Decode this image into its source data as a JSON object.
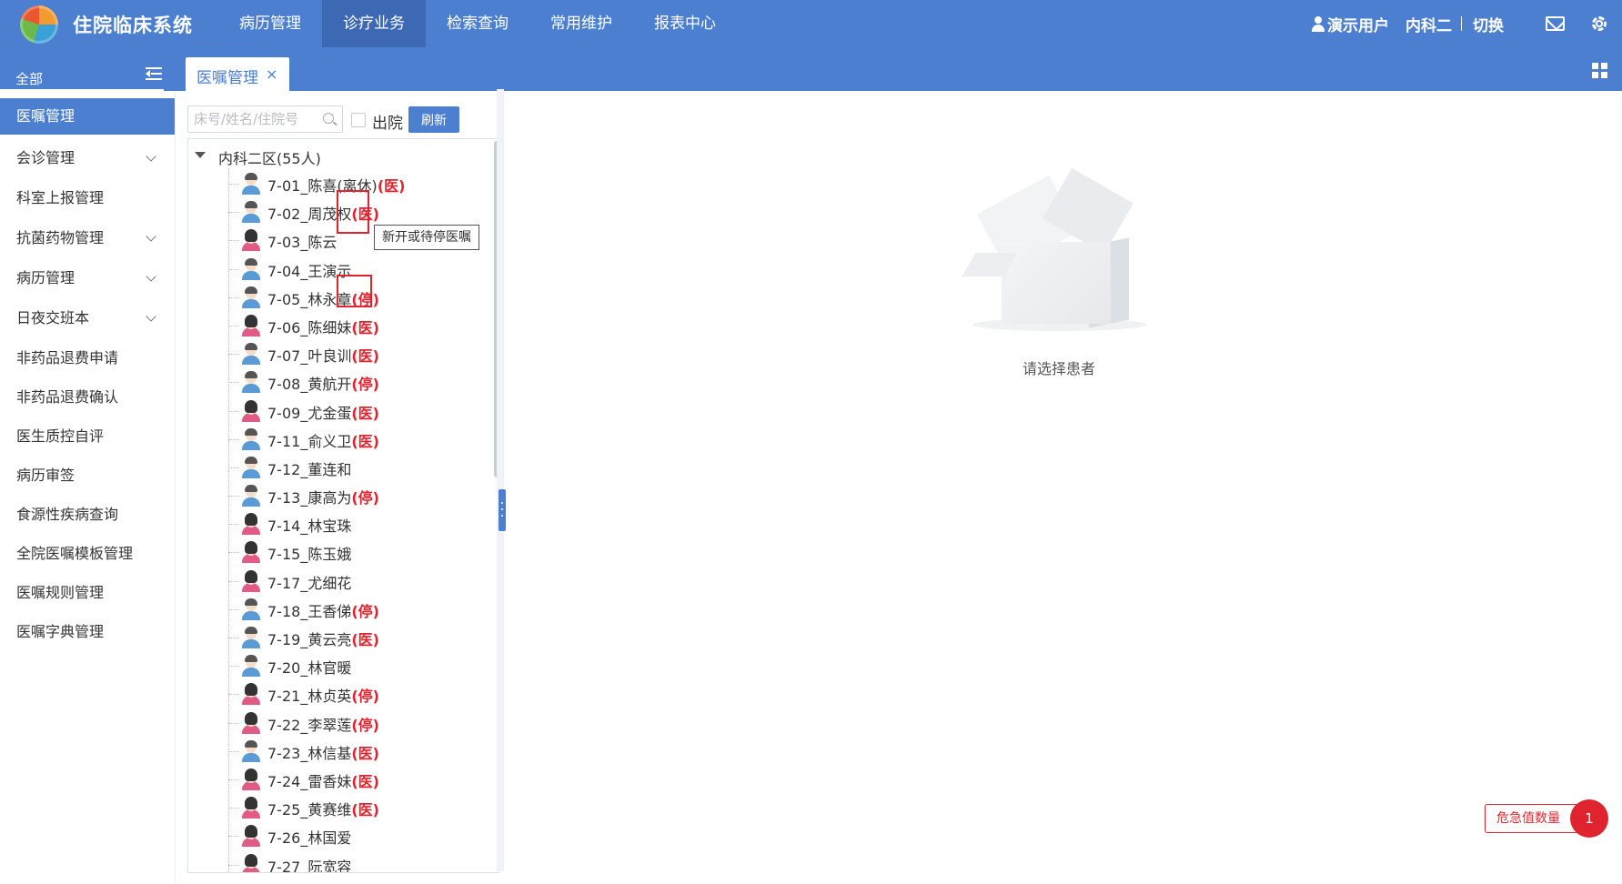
{
  "app": {
    "title": "住院临床系统"
  },
  "topnav": [
    {
      "label": "病历管理"
    },
    {
      "label": "诊疗业务",
      "active": true
    },
    {
      "label": "检索查询"
    },
    {
      "label": "常用维护"
    },
    {
      "label": "报表中心"
    }
  ],
  "header_right": {
    "user": "演示用户",
    "dept": "内科二",
    "switch": "切换"
  },
  "tabbar": {
    "all_label": "全部",
    "active_tab": "医嘱管理",
    "close_glyph": "×"
  },
  "sidebar": {
    "items": [
      {
        "label": "医嘱管理",
        "active": true
      },
      {
        "label": "会诊管理",
        "expandable": true
      },
      {
        "label": "科室上报管理"
      },
      {
        "label": "抗菌药物管理",
        "expandable": true
      },
      {
        "label": "病历管理",
        "expandable": true
      },
      {
        "label": "日夜交班本",
        "expandable": true
      },
      {
        "label": "非药品退费申请"
      },
      {
        "label": "非药品退费确认"
      },
      {
        "label": "医生质控自评"
      },
      {
        "label": "病历审签"
      },
      {
        "label": "食源性疾病查询"
      },
      {
        "label": "全院医嘱模板管理"
      },
      {
        "label": "医嘱规则管理"
      },
      {
        "label": "医嘱字典管理"
      }
    ]
  },
  "toolbar": {
    "search_placeholder": "床号/姓名/住院号",
    "discharge_label": "出院",
    "refresh_label": "刷新"
  },
  "tree": {
    "root_label": "内科二区(55人)",
    "patients": [
      {
        "name": "7-01_陈喜(离休)",
        "badge": "(医)",
        "gender": "male"
      },
      {
        "name": "7-02_周茂权",
        "badge": "(医)",
        "gender": "male"
      },
      {
        "name": "7-03_陈云",
        "badge": "",
        "gender": "female"
      },
      {
        "name": "7-04_王演示",
        "badge": "",
        "gender": "male"
      },
      {
        "name": "7-05_林永章",
        "badge": "(停)",
        "gender": "male"
      },
      {
        "name": "7-06_陈细妹",
        "badge": "(医)",
        "gender": "female"
      },
      {
        "name": "7-07_叶良训",
        "badge": "(医)",
        "gender": "male"
      },
      {
        "name": "7-08_黄航开",
        "badge": "(停)",
        "gender": "male"
      },
      {
        "name": "7-09_尤金蛋",
        "badge": "(医)",
        "gender": "female"
      },
      {
        "name": "7-11_俞义卫",
        "badge": "(医)",
        "gender": "male"
      },
      {
        "name": "7-12_董连和",
        "badge": "",
        "gender": "male"
      },
      {
        "name": "7-13_康高为",
        "badge": "(停)",
        "gender": "male"
      },
      {
        "name": "7-14_林宝珠",
        "badge": "",
        "gender": "female"
      },
      {
        "name": "7-15_陈玉娥",
        "badge": "",
        "gender": "female"
      },
      {
        "name": "7-17_尤细花",
        "badge": "",
        "gender": "female"
      },
      {
        "name": "7-18_王香俤",
        "badge": "(停)",
        "gender": "male"
      },
      {
        "name": "7-19_黄云亮",
        "badge": "(医)",
        "gender": "male"
      },
      {
        "name": "7-20_林官暖",
        "badge": "",
        "gender": "male"
      },
      {
        "name": "7-21_林贞英",
        "badge": "(停)",
        "gender": "female"
      },
      {
        "name": "7-22_李翠莲",
        "badge": "(停)",
        "gender": "female"
      },
      {
        "name": "7-23_林信基",
        "badge": "(医)",
        "gender": "male"
      },
      {
        "name": "7-24_雷香妹",
        "badge": "(医)",
        "gender": "female"
      },
      {
        "name": "7-25_黄赛维",
        "badge": "(医)",
        "gender": "female"
      },
      {
        "name": "7-26_林国爱",
        "badge": "",
        "gender": "female"
      },
      {
        "name": "7-27_阮宽容",
        "badge": "",
        "gender": "female"
      }
    ]
  },
  "tooltip": {
    "text": "新开或待停医嘱"
  },
  "main": {
    "empty_text": "请选择患者"
  },
  "critical": {
    "label": "危急值数量",
    "count": "1"
  },
  "colors": {
    "primary": "#4c7fd0",
    "nav_active": "#3d68b3",
    "danger": "#e0242f"
  }
}
